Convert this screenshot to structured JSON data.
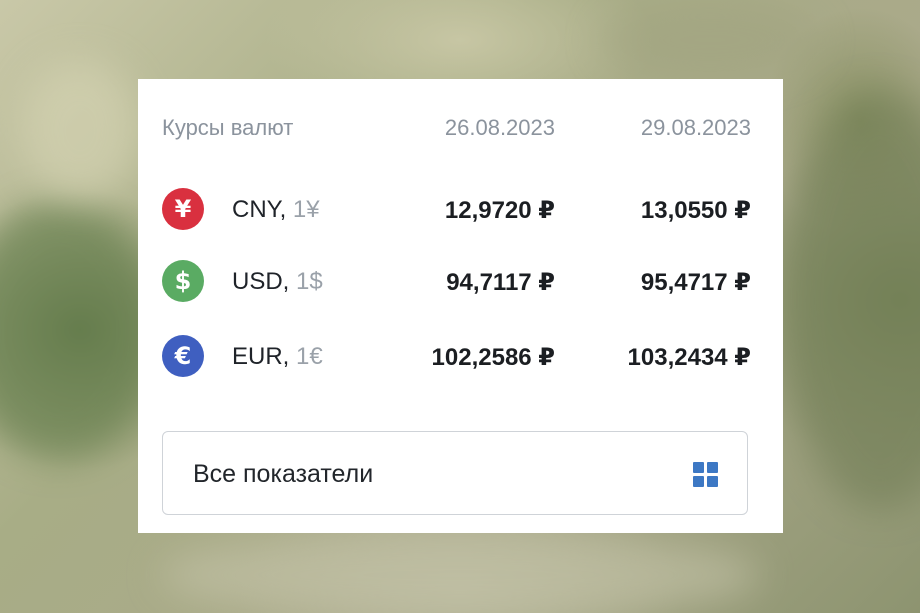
{
  "widget": {
    "title": "Курсы валют",
    "date1": "26.08.2023",
    "date2": "29.08.2023"
  },
  "rates": [
    {
      "symbol": "¥",
      "code": "CNY,",
      "unit": "1¥",
      "value1": "12,9720 ₽",
      "value2": "13,0550 ₽",
      "color": "#d9303f",
      "icon": "yuan-icon"
    },
    {
      "symbol": "$",
      "code": "USD,",
      "unit": "1$",
      "value1": "94,7117 ₽",
      "value2": "95,4717 ₽",
      "color": "#5aab63",
      "icon": "dollar-icon"
    },
    {
      "symbol": "€",
      "code": "EUR,",
      "unit": "1€",
      "value1": "102,2586 ₽",
      "value2": "103,2434 ₽",
      "color": "#3f5fc0",
      "icon": "euro-icon"
    }
  ],
  "all_button": {
    "label": "Все показатели",
    "icon": "grid-icon",
    "icon_color": "#3d78c4"
  }
}
